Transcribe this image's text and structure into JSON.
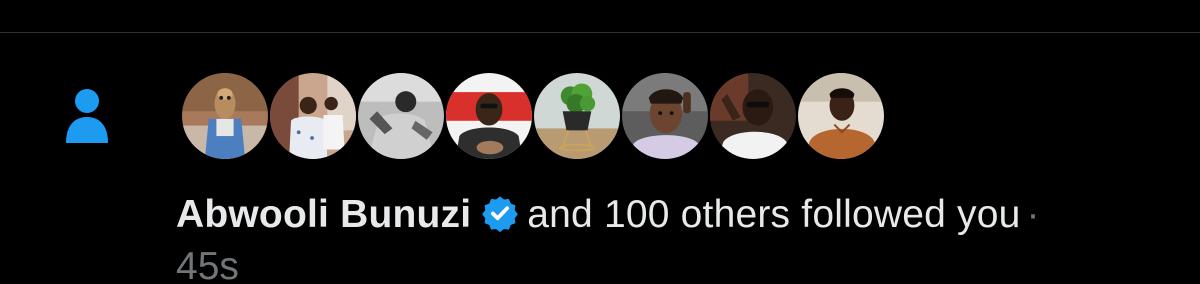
{
  "notification": {
    "type_icon": "person-icon",
    "name": "Abwooli Bunuzi",
    "verified_badge": "verified-badge-icon",
    "rest_text": "and 100 others followed you",
    "separator": "·",
    "time": "45s",
    "avatars": [
      {
        "name": "avatar-meerkat"
      },
      {
        "name": "avatar-two-men"
      },
      {
        "name": "avatar-bw-man"
      },
      {
        "name": "avatar-man-red-bg"
      },
      {
        "name": "avatar-plant"
      },
      {
        "name": "avatar-man-closeup"
      },
      {
        "name": "avatar-man-glasses"
      },
      {
        "name": "avatar-man-brown-sweater"
      }
    ]
  },
  "colors": {
    "background": "#000000",
    "primary_text": "#e7e9ea",
    "secondary_text": "#71767b",
    "accent": "#1d9bf0",
    "divider": "#2f3336"
  }
}
